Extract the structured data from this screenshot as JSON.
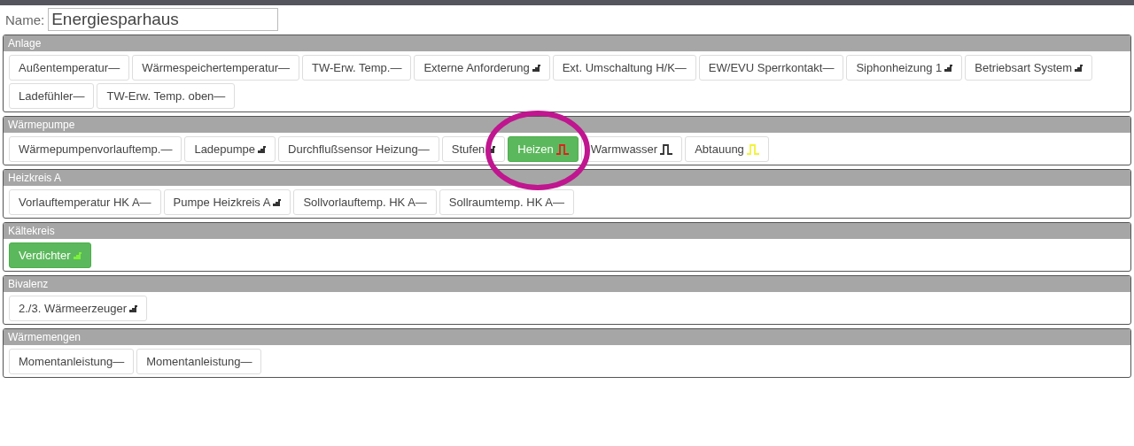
{
  "name_field": {
    "label": "Name:",
    "value": "Energiesparhaus"
  },
  "sections": [
    {
      "title": "Anlage",
      "items": [
        {
          "label": "Außentemperatur—",
          "kind": "plain",
          "active": false
        },
        {
          "label": "Wärmespeichertemperatur—",
          "kind": "plain",
          "active": false
        },
        {
          "label": "TW-Erw. Temp.—",
          "kind": "plain",
          "active": false
        },
        {
          "label": "Externe Anforderung",
          "kind": "steps",
          "color": "#333333",
          "active": false
        },
        {
          "label": "Ext. Umschaltung H/K—",
          "kind": "plain",
          "active": false
        },
        {
          "label": "EW/EVU Sperrkontakt—",
          "kind": "plain",
          "active": false
        },
        {
          "label": "Siphonheizung 1",
          "kind": "steps",
          "color": "#333333",
          "active": false
        },
        {
          "label": "Betriebsart System",
          "kind": "steps",
          "color": "#333333",
          "active": false
        },
        {
          "label": "Ladefühler—",
          "kind": "plain",
          "active": false
        },
        {
          "label": "TW-Erw. Temp. oben—",
          "kind": "plain",
          "active": false
        }
      ]
    },
    {
      "title": "Wärmepumpe",
      "items": [
        {
          "label": "Wärmepumpenvorlauftemp.—",
          "kind": "plain",
          "active": false,
          "circled": false
        },
        {
          "label": "Ladepumpe",
          "kind": "steps",
          "color": "#333333",
          "active": false,
          "circled": false
        },
        {
          "label": "Durchflußsensor Heizung—",
          "kind": "plain",
          "active": false,
          "circled": false
        },
        {
          "label": "Stufen",
          "kind": "steps",
          "color": "#333333",
          "active": false,
          "circled": false
        },
        {
          "label": "Heizen",
          "kind": "pulse",
          "color": "#e02020",
          "active": true,
          "circled": true
        },
        {
          "label": "Warmwasser",
          "kind": "pulse",
          "color": "#333333",
          "active": false,
          "circled": false
        },
        {
          "label": "Abtauung",
          "kind": "pulse",
          "color": "#f2f23a",
          "active": false,
          "circled": false
        }
      ]
    },
    {
      "title": "Heizkreis A",
      "items": [
        {
          "label": "Vorlauftemperatur HK A—",
          "kind": "plain",
          "active": false
        },
        {
          "label": "Pumpe Heizkreis A",
          "kind": "steps",
          "color": "#333333",
          "active": false
        },
        {
          "label": "Sollvorlauftemp. HK A—",
          "kind": "plain",
          "active": false
        },
        {
          "label": "Sollraumtemp. HK A—",
          "kind": "plain",
          "active": false
        }
      ]
    },
    {
      "title": "Kältekreis",
      "items": [
        {
          "label": "Verdichter",
          "kind": "steps",
          "color": "#7cf03c",
          "active": true
        }
      ]
    },
    {
      "title": "Bivalenz",
      "items": [
        {
          "label": "2./3. Wärmeerzeuger",
          "kind": "steps",
          "color": "#333333",
          "active": false
        }
      ]
    },
    {
      "title": "Wärmemengen",
      "items": [
        {
          "label": "Momentanleistung—",
          "kind": "plain",
          "active": false
        },
        {
          "label": "Momentanleistung—",
          "kind": "plain",
          "active": false
        }
      ]
    }
  ]
}
